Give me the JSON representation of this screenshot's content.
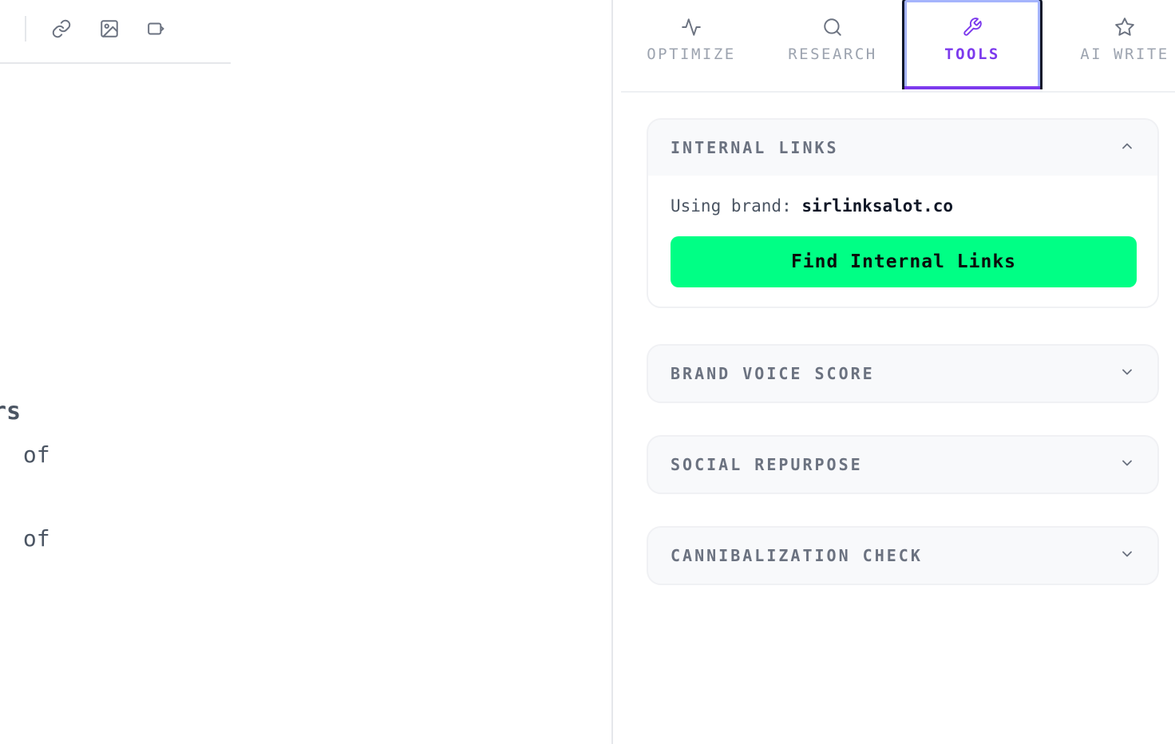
{
  "editor": {
    "toolbar": {
      "icons": [
        "link-icon",
        "image-icon",
        "video-icon"
      ]
    },
    "text_fragments": {
      "heading": "rs",
      "line1": " of",
      "line2": " of"
    }
  },
  "sidebar": {
    "tabs": [
      {
        "label": "OPTIMIZE",
        "icon": "activity-icon"
      },
      {
        "label": "RESEARCH",
        "icon": "search-icon"
      },
      {
        "label": "TOOLS",
        "icon": "wrench-icon",
        "active": true
      },
      {
        "label": "AI WRITE",
        "icon": "star-icon"
      }
    ],
    "panels": {
      "internal_links": {
        "title": "INTERNAL LINKS",
        "expanded": true,
        "brand_label": "Using brand: ",
        "brand_value": "sirlinksalot.co",
        "button_label": "Find Internal Links"
      },
      "brand_voice": {
        "title": "BRAND VOICE SCORE",
        "expanded": false
      },
      "social_repurpose": {
        "title": "SOCIAL REPURPOSE",
        "expanded": false
      },
      "cannibalization": {
        "title": "CANNIBALIZATION CHECK",
        "expanded": false
      }
    }
  },
  "colors": {
    "accent": "#7c3aed",
    "cta": "#00ff85",
    "muted_text": "#6b7280"
  }
}
